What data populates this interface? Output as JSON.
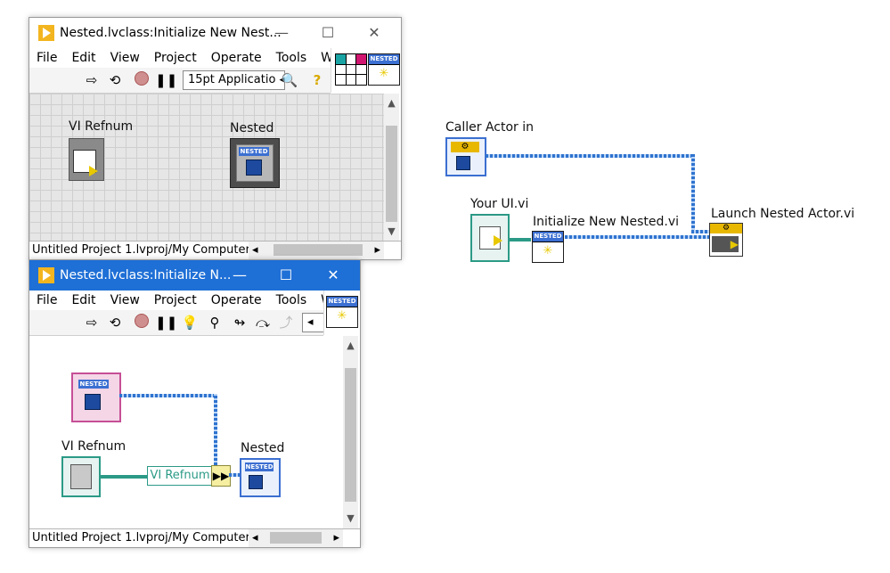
{
  "window1": {
    "title": "Nested.lvclass:Initialize New Nest...",
    "menu": [
      "File",
      "Edit",
      "View",
      "Project",
      "Operate",
      "Tools",
      "Wind"
    ],
    "font_ring": "15pt Applicatio",
    "canvas_labels": {
      "vi_refnum": "VI Refnum",
      "nested": "Nested"
    },
    "status_context": "Untitled Project 1.lvproj/My Computer",
    "icon_header": "NESTED"
  },
  "window2": {
    "title": "Nested.lvclass:Initialize N...",
    "menu": [
      "File",
      "Edit",
      "View",
      "Project",
      "Operate",
      "Tools",
      "Win"
    ],
    "diagram_labels": {
      "vi_refnum": "VI Refnum",
      "nested": "Nested",
      "bundle_field": "VI Refnum"
    },
    "status_context": "Untitled Project 1.lvproj/My Computer",
    "icon_header": "NESTED"
  },
  "diagram": {
    "caller_actor_label": "Caller Actor in",
    "your_ui_label": "Your UI.vi",
    "init_label": "Initialize New Nested.vi",
    "launch_label": "Launch Nested Actor.vi",
    "init_icon_header": "NESTED"
  },
  "colors": {
    "active_titlebar": "#1e6fd6",
    "wire": "#2f73cf",
    "grid_bg": "#e6e6e6"
  }
}
